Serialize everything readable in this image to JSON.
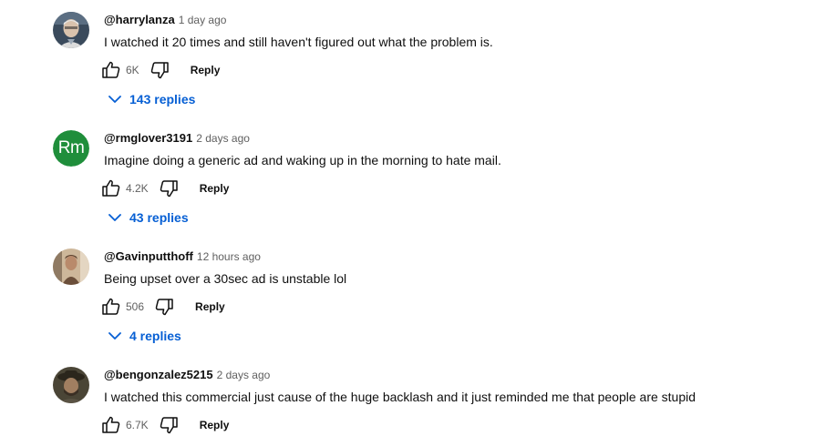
{
  "colors": {
    "link_blue": "#065fd4",
    "secondary_text": "#606060",
    "rm_avatar_bg": "#1f8e3b"
  },
  "comments": [
    {
      "author": "@harrylanza",
      "time": "1 day ago",
      "text": "I watched it 20 times and still haven't figured out what the problem is.",
      "likes": "6K",
      "reply_label": "Reply",
      "replies_label": "143 replies",
      "avatar_icon": "avatar-photo-icon"
    },
    {
      "author": "@rmglover3191",
      "time": "2 days ago",
      "text": "Imagine doing a generic ad and waking up in the morning to hate mail.",
      "likes": "4.2K",
      "reply_label": "Reply",
      "replies_label": "43 replies",
      "avatar_initials": "Rm"
    },
    {
      "author": "@Gavinputthoff",
      "time": "12 hours ago",
      "text": "Being upset over a 30sec ad is unstable lol",
      "likes": "506",
      "reply_label": "Reply",
      "replies_label": "4 replies",
      "avatar_icon": "avatar-photo-icon"
    },
    {
      "author": "@bengonzalez5215",
      "time": "2 days ago",
      "text": "I watched this commercial just cause of the huge backlash and it just reminded me that people are stupid",
      "likes": "6.7K",
      "reply_label": "Reply",
      "avatar_icon": "avatar-photo-icon"
    }
  ]
}
